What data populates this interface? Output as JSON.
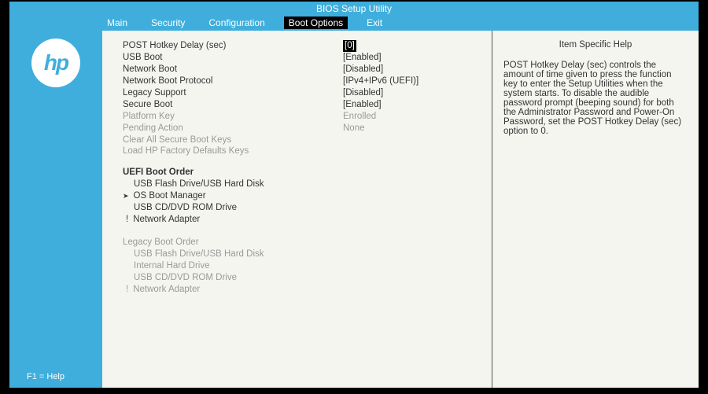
{
  "title": "BIOS Setup Utility",
  "logo": "hp",
  "menu": {
    "items": [
      "Main",
      "Security",
      "Configuration",
      "Boot Options",
      "Exit"
    ],
    "activeIndex": 3
  },
  "settings": [
    {
      "label": "POST Hotkey Delay (sec)",
      "value": "[0]",
      "selected": true,
      "grayed": false
    },
    {
      "label": "USB Boot",
      "value": "[Enabled]",
      "selected": false,
      "grayed": false
    },
    {
      "label": "Network Boot",
      "value": "[Disabled]",
      "selected": false,
      "grayed": false
    },
    {
      "label": "Network Boot Protocol",
      "value": "[IPv4+IPv6 (UEFI)]",
      "selected": false,
      "grayed": false
    },
    {
      "label": "Legacy Support",
      "value": "[Disabled]",
      "selected": false,
      "grayed": false
    },
    {
      "label": "Secure Boot",
      "value": "[Enabled]",
      "selected": false,
      "grayed": false
    },
    {
      "label": "Platform Key",
      "value": "Enrolled",
      "selected": false,
      "grayed": true
    },
    {
      "label": "Pending Action",
      "value": "None",
      "selected": false,
      "grayed": true
    },
    {
      "label": "Clear All Secure Boot Keys",
      "value": "",
      "selected": false,
      "grayed": true
    },
    {
      "label": "Load HP Factory Defaults Keys",
      "value": "",
      "selected": false,
      "grayed": true
    }
  ],
  "uefiBootOrder": {
    "header": "UEFI Boot Order",
    "items": [
      {
        "text": "USB Flash Drive/USB Hard Disk",
        "marker": "none"
      },
      {
        "text": "OS Boot Manager",
        "marker": "arrow"
      },
      {
        "text": "USB CD/DVD ROM Drive",
        "marker": "none"
      },
      {
        "text": "Network Adapter",
        "marker": "excl"
      }
    ]
  },
  "legacyBootOrder": {
    "header": "Legacy Boot Order",
    "items": [
      {
        "text": "USB Flash Drive/USB Hard Disk",
        "marker": "none"
      },
      {
        "text": "Internal Hard Drive",
        "marker": "none"
      },
      {
        "text": "USB CD/DVD ROM Drive",
        "marker": "none"
      },
      {
        "text": "Network Adapter",
        "marker": "excl"
      }
    ]
  },
  "help": {
    "heading": "Item Specific Help",
    "text": "POST Hotkey Delay (sec) controls the amount of time given to press the function key to enter the Setup Utilities when the system starts. To disable the audible password prompt (beeping sound) for both the Administrator Password and Power-On Password, set the POST Hotkey Delay (sec) option to 0."
  },
  "footerHelp": "F1 = Help"
}
